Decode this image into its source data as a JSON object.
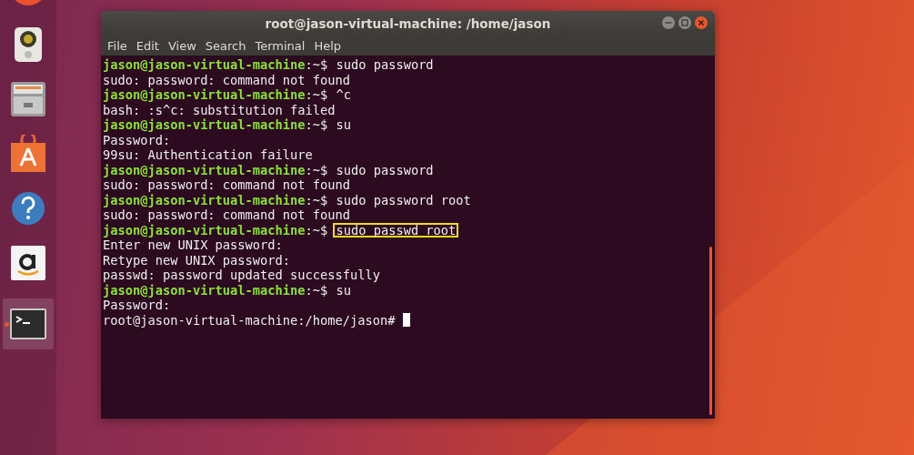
{
  "dock": {
    "items": [
      {
        "kind": "browser",
        "active": false
      },
      {
        "kind": "speaker",
        "active": false
      },
      {
        "kind": "cabinet",
        "active": false
      },
      {
        "kind": "bag",
        "active": false
      },
      {
        "kind": "help",
        "active": false
      },
      {
        "kind": "amazon",
        "active": false
      },
      {
        "kind": "terminal",
        "active": true
      }
    ]
  },
  "window": {
    "title": "root@jason-virtual-machine: /home/jason"
  },
  "menu": [
    "File",
    "Edit",
    "View",
    "Search",
    "Terminal",
    "Help"
  ],
  "lines": [
    {
      "kind": "prompt",
      "user": "jason@jason-virtual-machine",
      "path": ":~$",
      "command": "sudo password",
      "highlighted": false
    },
    {
      "kind": "output",
      "text": "sudo: password: command not found"
    },
    {
      "kind": "prompt",
      "user": "jason@jason-virtual-machine",
      "path": ":~$",
      "command": "^c",
      "highlighted": false
    },
    {
      "kind": "output",
      "text": "bash: :s^c: substitution failed"
    },
    {
      "kind": "prompt",
      "user": "jason@jason-virtual-machine",
      "path": ":~$",
      "command": "su",
      "highlighted": false
    },
    {
      "kind": "output",
      "text": "Password:"
    },
    {
      "kind": "output",
      "text": "99su: Authentication failure"
    },
    {
      "kind": "prompt",
      "user": "jason@jason-virtual-machine",
      "path": ":~$",
      "command": "sudo password",
      "highlighted": false
    },
    {
      "kind": "output",
      "text": "sudo: password: command not found"
    },
    {
      "kind": "prompt",
      "user": "jason@jason-virtual-machine",
      "path": ":~$",
      "command": "sudo password root",
      "highlighted": false
    },
    {
      "kind": "output",
      "text": "sudo: password: command not found"
    },
    {
      "kind": "prompt",
      "user": "jason@jason-virtual-machine",
      "path": ":~$",
      "command": "sudo passwd root",
      "highlighted": true
    },
    {
      "kind": "output",
      "text": "Enter new UNIX password:"
    },
    {
      "kind": "output",
      "text": "Retype new UNIX password:"
    },
    {
      "kind": "output",
      "text": "passwd: password updated successfully"
    },
    {
      "kind": "prompt",
      "user": "jason@jason-virtual-machine",
      "path": ":~$",
      "command": "su",
      "highlighted": false
    },
    {
      "kind": "output",
      "text": "Password:"
    },
    {
      "kind": "root",
      "text": "root@jason-virtual-machine:/home/jason#",
      "cursor": true
    }
  ]
}
